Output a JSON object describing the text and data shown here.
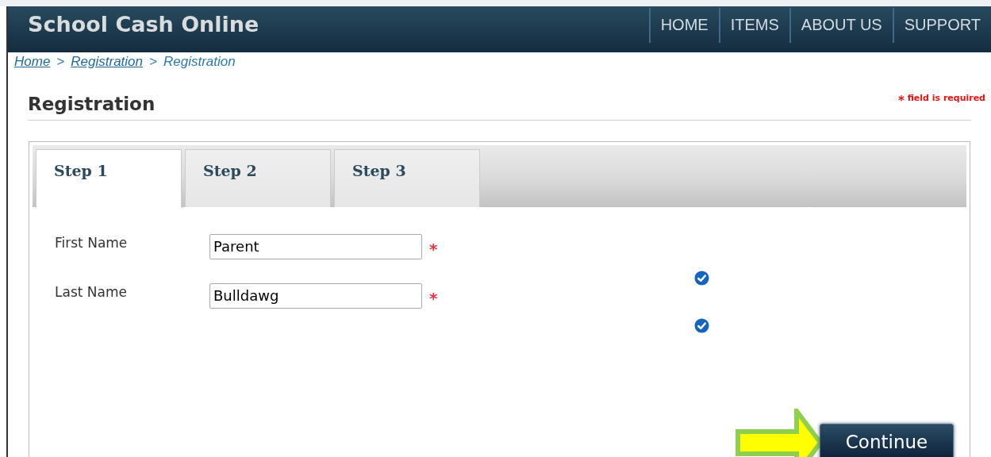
{
  "header": {
    "title": "School Cash Online",
    "nav": [
      "HOME",
      "ITEMS",
      "ABOUT US",
      "SUPPORT"
    ]
  },
  "breadcrumb": [
    {
      "label": "Home",
      "link": true
    },
    {
      "separator": ">",
      "label": "Registration",
      "link": true
    },
    {
      "separator": ">",
      "label": "Registration",
      "link": false
    }
  ],
  "page_title": "Registration",
  "required_note": {
    "mark": "*",
    "text": "field is required"
  },
  "tabs": [
    {
      "label": "Step 1",
      "selected": true
    },
    {
      "label": "Step 2",
      "selected": false
    },
    {
      "label": "Step 3",
      "selected": false
    }
  ],
  "fields": [
    {
      "label": "First Name",
      "value": "Parent",
      "required_mark": "*",
      "valid": true
    },
    {
      "label": "Last Name",
      "value": "Bulldawg",
      "required_mark": "*",
      "valid": true
    }
  ],
  "continue_button": "Continue",
  "pointer_arrow": true
}
